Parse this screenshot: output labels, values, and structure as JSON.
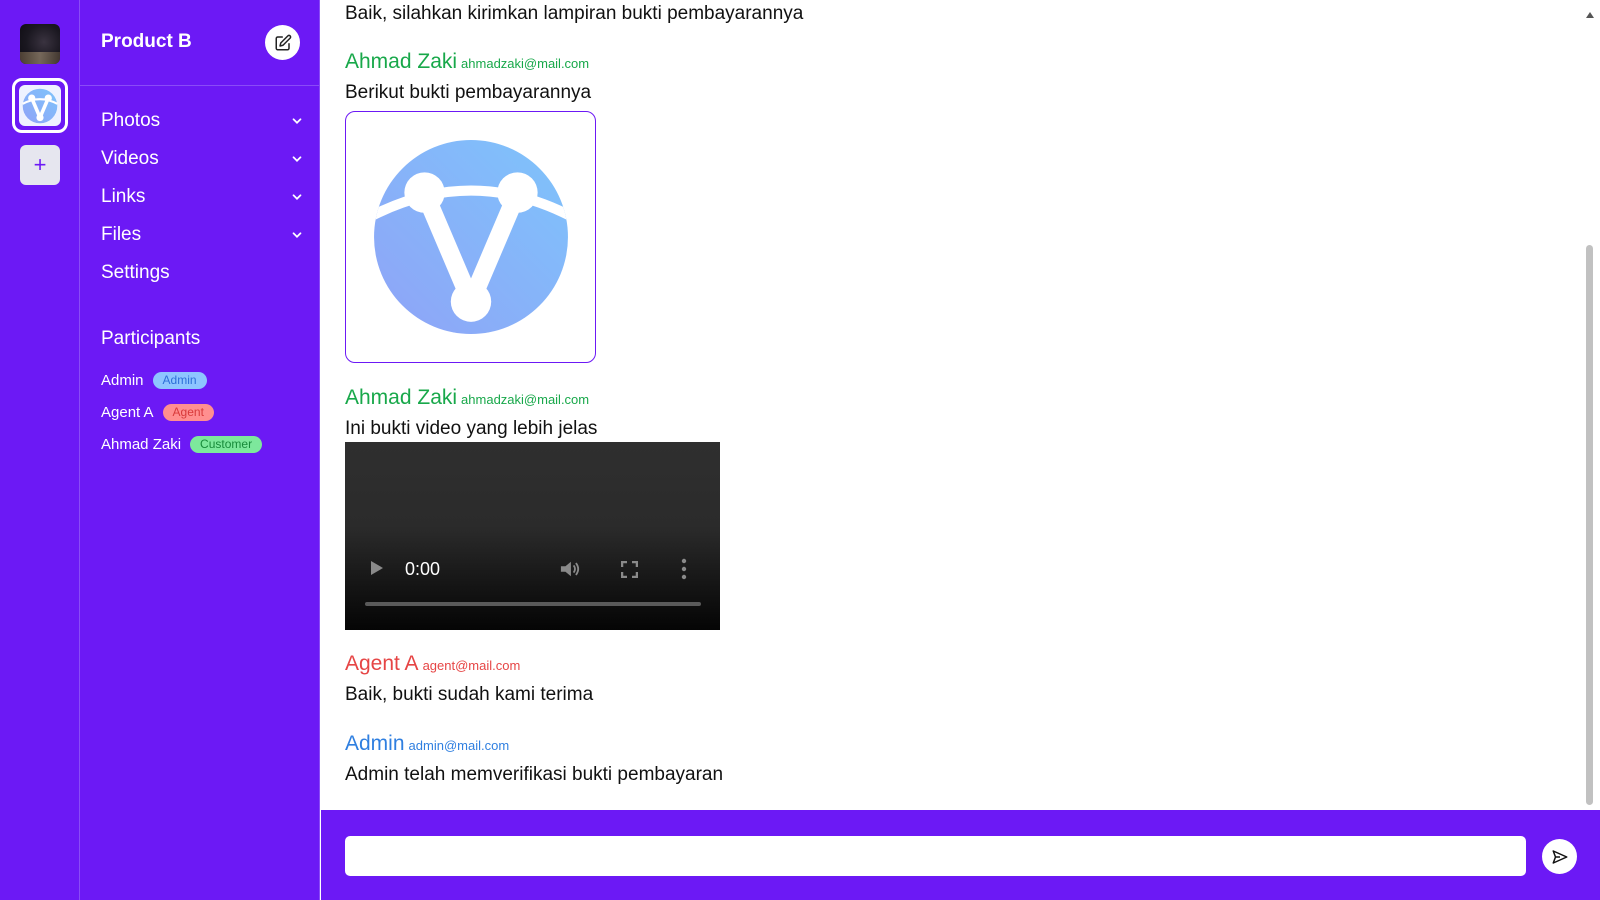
{
  "rail": {
    "avatar_icon": "workspace-avatar-icon",
    "logo_icon": "app-logo-icon",
    "add_label": "+"
  },
  "sidebar": {
    "title": "Product B",
    "edit_icon": "edit-icon",
    "menu": [
      {
        "label": "Photos",
        "expandable": true
      },
      {
        "label": "Videos",
        "expandable": true
      },
      {
        "label": "Links",
        "expandable": true
      },
      {
        "label": "Files",
        "expandable": true
      },
      {
        "label": "Settings",
        "expandable": false
      }
    ],
    "participants_title": "Participants",
    "participants": [
      {
        "name": "Admin",
        "role": "Admin"
      },
      {
        "name": "Agent A",
        "role": "Agent"
      },
      {
        "name": "Ahmad Zaki",
        "role": "Customer"
      }
    ]
  },
  "chat": {
    "messages": [
      {
        "sender": "",
        "email": "",
        "text": "Baik, silahkan kirimkan lampiran bukti pembayarannya"
      },
      {
        "sender": "Ahmad Zaki",
        "email": "ahmadzaki@mail.com",
        "text": "Berikut bukti pembayarannya",
        "attachment": "image"
      },
      {
        "sender": "Ahmad Zaki",
        "email": "ahmadzaki@mail.com",
        "text": "Ini bukti video yang lebih jelas",
        "attachment": "video"
      },
      {
        "sender": "Agent A",
        "email": "agent@mail.com",
        "text": "Baik, bukti sudah kami terima"
      },
      {
        "sender": "Admin",
        "email": "admin@mail.com",
        "text": "Admin telah memverifikasi bukti pembayaran"
      }
    ],
    "video": {
      "time": "0:00"
    }
  },
  "composer": {
    "placeholder": "",
    "send_icon": "send-icon"
  },
  "colors": {
    "brand": "#6c19f5",
    "customer": "#18a84a",
    "agent": "#e64545",
    "admin": "#2f7fe0"
  }
}
